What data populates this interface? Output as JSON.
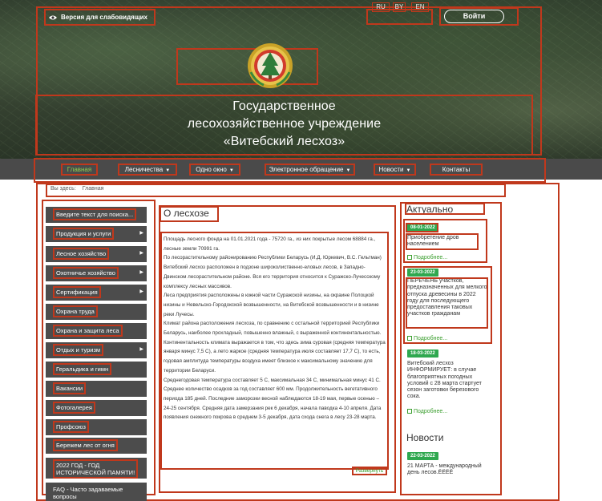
{
  "header": {
    "accessibility_label": "Версия для слабовидящих",
    "languages": [
      "RU",
      "BY",
      "EN"
    ],
    "login_label": "Войти",
    "org_title_lines": [
      "Государственное",
      "лесохозяйственное учреждение",
      "«Витебский лесхоз»"
    ]
  },
  "nav": {
    "items": [
      {
        "label": "Главная",
        "active": true
      },
      {
        "label": "Лесничества",
        "dropdown": true
      },
      {
        "label": "Одно окно",
        "dropdown": true
      },
      {
        "label": "Электронное обращение",
        "dropdown": true
      },
      {
        "label": "Новости",
        "dropdown": true
      },
      {
        "label": "Контакты"
      }
    ]
  },
  "breadcrumb": {
    "prefix": "Вы здесь:",
    "current": "Главная"
  },
  "sidebar": {
    "items": [
      {
        "label": "Введите текст для поиска..."
      },
      {
        "label": "Продукция и услуги",
        "arrow": true
      },
      {
        "label": "Лесное хозяйство",
        "arrow": true
      },
      {
        "label": "Охотничье хозяйство",
        "arrow": true
      },
      {
        "label": "Сертификация",
        "arrow": true
      },
      {
        "label": "Охрана труда"
      },
      {
        "label": "Охрана и защита леса"
      },
      {
        "label": "Отдых и туризм",
        "arrow": true
      },
      {
        "label": "Геральдика и гимн"
      },
      {
        "label": "Вакансии"
      },
      {
        "label": "Фотогалерея"
      },
      {
        "label": "Профсоюз"
      },
      {
        "label": "Бережем лес от огня"
      },
      {
        "label_lines": [
          "2022 ГОД - ГОД",
          "ИСТОРИЧЕСКОЙ ПАМЯТИ!"
        ]
      },
      {
        "label_lines": [
          "FAQ - Часто задаваемые",
          "вопросы"
        ]
      }
    ]
  },
  "article": {
    "title": "О лесхозе",
    "paragraphs": [
      "Площадь лесного фонда на 01.01.2021 года - 75720 га., из них покрытые лесом 68884 га., лесные земли 70991 га.",
      "По лесорастительному районированию Республики Беларусь (И.Д. Юркевич, В.С. Гельтман) Витебский лесхоз расположен в подзоне широколиственно-еловых лесов, в Западно-Двинском лесорастительном районе. Вся его территория относится к Суражско-Лучесскому комплексу лесных массивов.",
      "Леса предприятия расположены в южной части Суражской низины, на окраине Полоцкой низины и Невельско-Городокской возвышенности, на Витебской возвышенности и в низине реки Лучесы.",
      "Климат района расположения лесхоза, по сравнению с остальной территорией Республики Беларусь, наиболее прохладный, повышенно влажный, с выраженной континентальностью. Континентальность климата выражается в том, что здесь зима суровая (средняя температура января минус 7,5 С), а лето жаркое (средняя температура июля составляет 17,7 С), то есть, годовая амплитуда температуры воздуха имеет близкое к максимальному значению для территории Беларуси.",
      "Среднегодовая температура составляет 5 С, максимальная 34 С, минимальная минус 41 С. Среднее количество осадков за год составляет 600 мм. Продолжительность вегетативного периода 185 дней. Последние заморозки весной наблюдаются 18-19 мая, первые осенью – 24-25 сентября. Средняя дата замерзания рек 6 декабря, начала паводка 4-10 апреля. Дата появления снежного покрова в среднем 3-5 декабря, дата схода снега в лесу 23-28 марта."
    ],
    "expand_label": "Развернуть"
  },
  "right": {
    "actual_title": "Актуально",
    "more_label": "Подробнее...",
    "actual": [
      {
        "date": "08-01-2022",
        "text": "Приобретение дров населением"
      },
      {
        "date": "23-03-2022",
        "text": "ПЕРЕЧЕНЬ участков, предназначенных для мелкого отпуска древесины в 2022 году для последующего предоставления таковых участков гражданам"
      },
      {
        "date": "18-03-2022",
        "text": "Витебский лесхоз ИНФОРМИРУЕТ: в случае благоприятных погодных условий с 28 марта стартует сезон заготовки березового сока."
      }
    ],
    "news_title": "Новости",
    "news": [
      {
        "date": "22-03-2022",
        "text": "21 МАРТА - международный день лесов.ЁЁЁЁ"
      }
    ]
  },
  "colors": {
    "accent": "#2fa84f",
    "nav_bg": "#4a4a4a",
    "sidebar_bg": "#4c4c4c",
    "annotation": "#c0381c"
  }
}
